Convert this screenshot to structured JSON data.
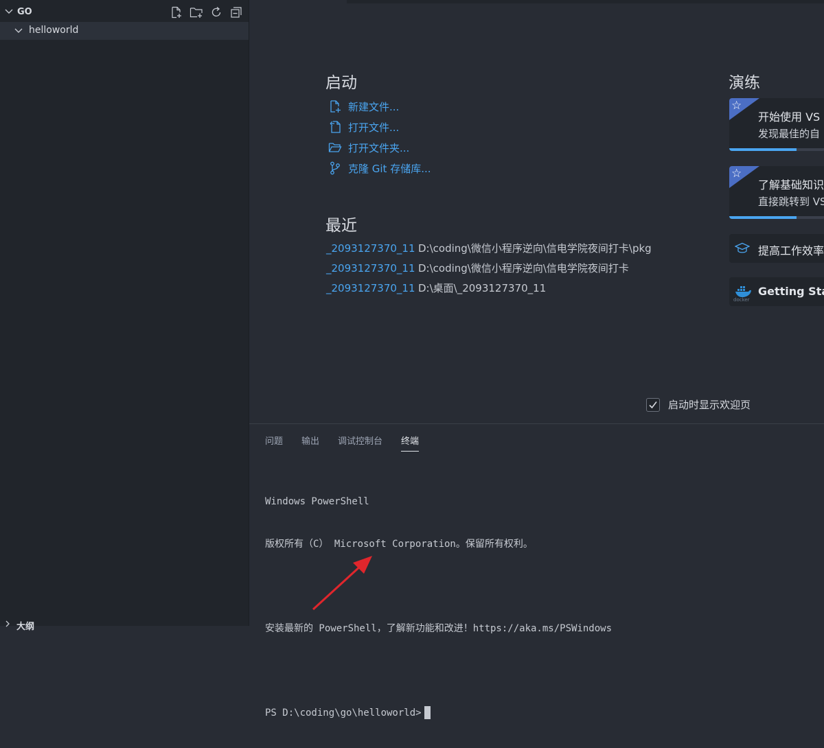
{
  "sidebar": {
    "title": "GO",
    "actions": [
      "new-file-icon",
      "new-folder-icon",
      "refresh-icon",
      "collapse-all-icon"
    ],
    "folder": "helloworld",
    "outline_title": "大纲"
  },
  "welcome": {
    "start": {
      "title": "启动",
      "items": [
        {
          "label": "新建文件...",
          "icon": "new-file-icon"
        },
        {
          "label": "打开文件...",
          "icon": "open-file-icon"
        },
        {
          "label": "打开文件夹...",
          "icon": "open-folder-icon"
        },
        {
          "label": "克隆 Git 存储库...",
          "icon": "git-branch-icon"
        }
      ]
    },
    "recent": {
      "title": "最近",
      "items": [
        {
          "name": "_2093127370_11",
          "path": "D:\\coding\\微信小程序逆向\\信电学院夜间打卡\\pkg"
        },
        {
          "name": "_2093127370_11",
          "path": "D:\\coding\\微信小程序逆向\\信电学院夜间打卡"
        },
        {
          "name": "_2093127370_11",
          "path": "D:\\桌面\\_2093127370_11"
        }
      ]
    },
    "walkthroughs": {
      "title": "演练",
      "cards": [
        {
          "title": "开始使用 VS",
          "subtitle": "发现最佳的自",
          "progress": 0.7
        },
        {
          "title": "了解基础知识",
          "subtitle": "直接跳转到 VS",
          "progress": 0.7
        },
        {
          "title": "提高工作效率"
        },
        {
          "title": "Getting Start",
          "icon_label": "docker"
        }
      ]
    },
    "show_on_startup": {
      "label": "启动时显示欢迎页",
      "checked": true
    }
  },
  "panel": {
    "tabs": [
      "问题",
      "输出",
      "调试控制台",
      "终端"
    ],
    "active_tab": "终端",
    "terminal_lines": [
      "Windows PowerShell",
      "版权所有（C） Microsoft Corporation。保留所有权利。",
      "",
      "安装最新的 PowerShell，了解新功能和改进！https://aka.ms/PSWindows",
      "",
      "PS D:\\coding\\go\\helloworld>"
    ]
  },
  "colors": {
    "accent": "#4aa5f0",
    "annotation_arrow": "#e0262c",
    "ribbon": "#4b6ec4"
  }
}
